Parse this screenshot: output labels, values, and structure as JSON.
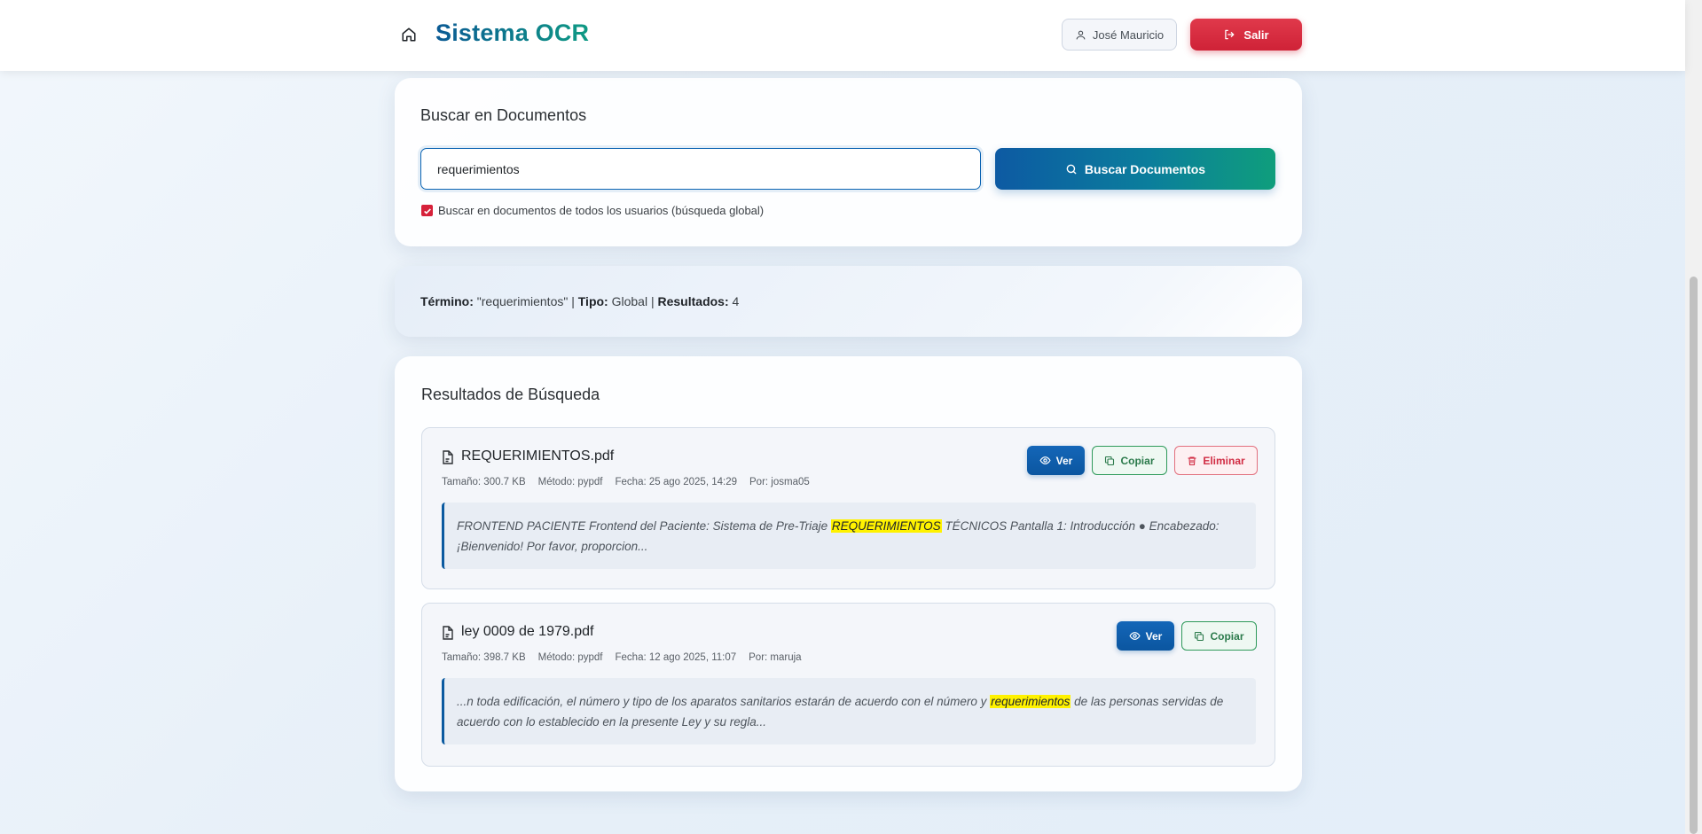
{
  "header": {
    "brand": "Sistema OCR",
    "user_name": "José Mauricio",
    "logout_label": "Salir"
  },
  "search": {
    "title": "Buscar en Documentos",
    "query": "requerimientos",
    "button_label": "Buscar Documentos",
    "global_checked": true,
    "global_label": "Buscar en documentos de todos los usuarios (búsqueda global)"
  },
  "summary": {
    "term_label": "Término:",
    "term_value": "\"requerimientos\"",
    "sep1": "|",
    "type_label": "Tipo:",
    "type_value": "Global",
    "sep2": "|",
    "results_label": "Resultados:",
    "results_value": "4"
  },
  "results": {
    "title": "Resultados de Búsqueda",
    "items": [
      {
        "file_name": "REQUERIMIENTOS.pdf",
        "size": "Tamaño: 300.7 KB",
        "method": "Método: pypdf",
        "date": "Fecha: 25 ago 2025, 14:29",
        "owner": "Por: josma05",
        "excerpt_before": "FRONTEND PACIENTE Frontend del Paciente: Sistema de Pre-Triaje ",
        "excerpt_match": "REQUERIMIENTOS",
        "excerpt_after": " TÉCNICOS Pantalla 1: Introducción ● Encabezado: ¡Bienvenido! Por favor, proporcion...",
        "actions": {
          "view": "Ver",
          "copy": "Copiar",
          "delete": "Eliminar"
        }
      },
      {
        "file_name": "ley 0009 de 1979.pdf",
        "size": "Tamaño: 398.7 KB",
        "method": "Método: pypdf",
        "date": "Fecha: 12 ago 2025, 11:07",
        "owner": "Por: maruja",
        "excerpt_before": "...n toda edificación, el número y tipo de los aparatos sanitarios estarán de acuerdo con el número y ",
        "excerpt_match": "requerimientos",
        "excerpt_after": " de las personas servidas de acuerdo con lo establecido en la presente Ley y su regla...",
        "actions": {
          "view": "Ver",
          "copy": "Copiar"
        }
      }
    ]
  },
  "colors": {
    "primary": "#0b5aa0",
    "accent_green": "#0f9e7c",
    "danger": "#d6213a",
    "highlight": "#fff200"
  }
}
